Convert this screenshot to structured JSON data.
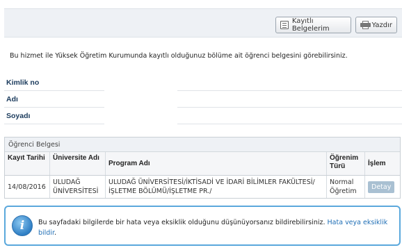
{
  "toolbar": {
    "kayitli_label": "Kayıtlı Belgelerim",
    "yazdir_label": "Yazdır"
  },
  "intro_text": "Bu hizmet ile Yüksek Öğretim Kurumunda kayıtlı olduğunuz bölüme ait öğrenci belgesini görebilirsiniz.",
  "identity": {
    "kimlik_label": "Kimlik no",
    "adi_label": "Adı",
    "soyadi_label": "Soyadı"
  },
  "panel": {
    "title": "Öğrenci Belgesi",
    "headers": [
      "Kayıt Tarihi",
      "Üniversite Adı",
      "Program Adı",
      "Öğrenim Türü",
      "İşlem"
    ],
    "row": {
      "kayit_tarihi": "14/08/2016",
      "universite": "ULUDAĞ ÜNİVERSİTESİ",
      "program": "ULUDAĞ ÜNİVERSİTESİ/İKTİSADİ VE İDARİ BİLİMLER FAKÜLTESİ/İŞLETME BÖLÜMÜ/İŞLETME PR./",
      "ogrenim_turu": "Normal Öğretim",
      "islem_label": "Detay"
    }
  },
  "notice": {
    "text": "Bu sayfadaki bilgilerde bir hata veya eksiklik olduğunu düşünüyorsanız bildirebilirsiniz.",
    "link_label": "Hata veya eksiklik bildir",
    "tail": "."
  },
  "colors": {
    "accent": "#5aa8dc",
    "label_blue": "#1a3a5c",
    "link": "#1f6eb5",
    "button_detay": "#a9c0d2"
  }
}
